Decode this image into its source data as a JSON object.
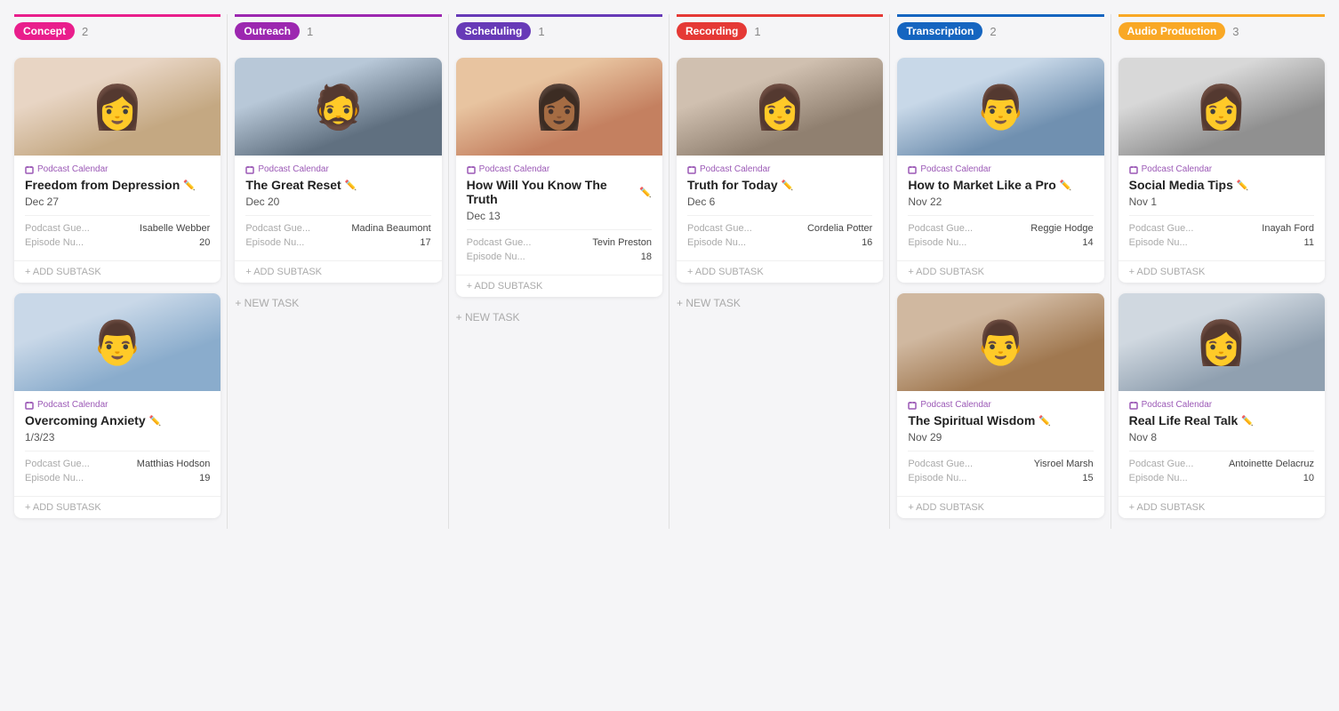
{
  "columns": [
    {
      "id": "concept",
      "label": "Concept",
      "count": 2,
      "color_class": "col-concept",
      "cards": [
        {
          "id": "card-1",
          "meta": "Podcast Calendar",
          "title": "Freedom from Depression",
          "date": "Dec 27",
          "guest_label": "Podcast Gue...",
          "guest_value": "Isabelle Webber",
          "episode_label": "Episode Nu...",
          "episode_value": "20",
          "image_bg": "#d4b8a0",
          "image_emoji": "👩"
        },
        {
          "id": "card-2",
          "meta": "Podcast Calendar",
          "title": "Overcoming Anxiety",
          "date": "1/3/23",
          "guest_label": "Podcast Gue...",
          "guest_value": "Matthias Hodson",
          "episode_label": "Episode Nu...",
          "episode_value": "19",
          "image_bg": "#7b9eb8",
          "image_emoji": "👨"
        }
      ],
      "show_new_task": false,
      "add_subtask_label": "+ ADD SUBTASK"
    },
    {
      "id": "outreach",
      "label": "Outreach",
      "count": 1,
      "color_class": "col-outreach",
      "cards": [
        {
          "id": "card-3",
          "meta": "Podcast Calendar",
          "title": "The Great Reset",
          "date": "Dec 20",
          "guest_label": "Podcast Gue...",
          "guest_value": "Madina Beaumont",
          "episode_label": "Episode Nu...",
          "episode_value": "17",
          "image_bg": "#5d7a8a",
          "image_emoji": "🧔"
        }
      ],
      "show_new_task": true,
      "new_task_label": "+ NEW TASK",
      "add_subtask_label": "+ ADD SUBTASK"
    },
    {
      "id": "scheduling",
      "label": "Scheduling",
      "count": 1,
      "color_class": "col-scheduling",
      "cards": [
        {
          "id": "card-4",
          "meta": "Podcast Calendar",
          "title": "How Will You Know The Truth",
          "date": "Dec 13",
          "guest_label": "Podcast Gue...",
          "guest_value": "Tevin Preston",
          "episode_label": "Episode Nu...",
          "episode_value": "18",
          "image_bg": "#c4875a",
          "image_emoji": "👩🏾"
        }
      ],
      "show_new_task": true,
      "new_task_label": "+ NEW TASK",
      "add_subtask_label": "+ ADD SUBTASK"
    },
    {
      "id": "recording",
      "label": "Recording",
      "count": 1,
      "color_class": "col-recording",
      "cards": [
        {
          "id": "card-5",
          "meta": "Podcast Calendar",
          "title": "Truth for Today",
          "date": "Dec 6",
          "guest_label": "Podcast Gue...",
          "guest_value": "Cordelia Potter",
          "episode_label": "Episode Nu...",
          "episode_value": "16",
          "image_bg": "#8a7060",
          "image_emoji": "👩"
        }
      ],
      "show_new_task": true,
      "new_task_label": "+ NEW TASK",
      "add_subtask_label": "+ ADD SUBTASK"
    },
    {
      "id": "transcription",
      "label": "Transcription",
      "count": 2,
      "color_class": "col-transcription",
      "cards": [
        {
          "id": "card-6",
          "meta": "Podcast Calendar",
          "title": "How to Market Like a Pro",
          "date": "Nov 22",
          "guest_label": "Podcast Gue...",
          "guest_value": "Reggie Hodge",
          "episode_label": "Episode Nu...",
          "episode_value": "14",
          "image_bg": "#6a8ab0",
          "image_emoji": "👨"
        },
        {
          "id": "card-7",
          "meta": "Podcast Calendar",
          "title": "The Spiritual Wisdom",
          "date": "Nov 29",
          "guest_label": "Podcast Gue...",
          "guest_value": "Yisroel Marsh",
          "episode_label": "Episode Nu...",
          "episode_value": "15",
          "image_bg": "#b87045",
          "image_emoji": "👨"
        }
      ],
      "show_new_task": false,
      "add_subtask_label": "+ ADD SUBTASK"
    },
    {
      "id": "audio",
      "label": "Audio Production",
      "count": 3,
      "color_class": "col-audio",
      "cards": [
        {
          "id": "card-8",
          "meta": "Podcast Calendar",
          "title": "Social Media Tips",
          "date": "Nov 1",
          "guest_label": "Podcast Gue...",
          "guest_value": "Inayah Ford",
          "episode_label": "Episode Nu...",
          "episode_value": "11",
          "image_bg": "#8a8a8a",
          "image_emoji": "👩"
        },
        {
          "id": "card-9",
          "meta": "Podcast Calendar",
          "title": "Real Life Real Talk",
          "date": "Nov 8",
          "guest_label": "Podcast Gue...",
          "guest_value": "Antoinette Delacruz",
          "episode_label": "Episode Nu...",
          "episode_value": "10",
          "image_bg": "#a0a8b0",
          "image_emoji": "👩"
        }
      ],
      "show_new_task": false,
      "add_subtask_label": "+ ADD SUBTASK"
    }
  ],
  "icons": {
    "calendar": "📅",
    "edit": "✏️",
    "plus": "+"
  }
}
